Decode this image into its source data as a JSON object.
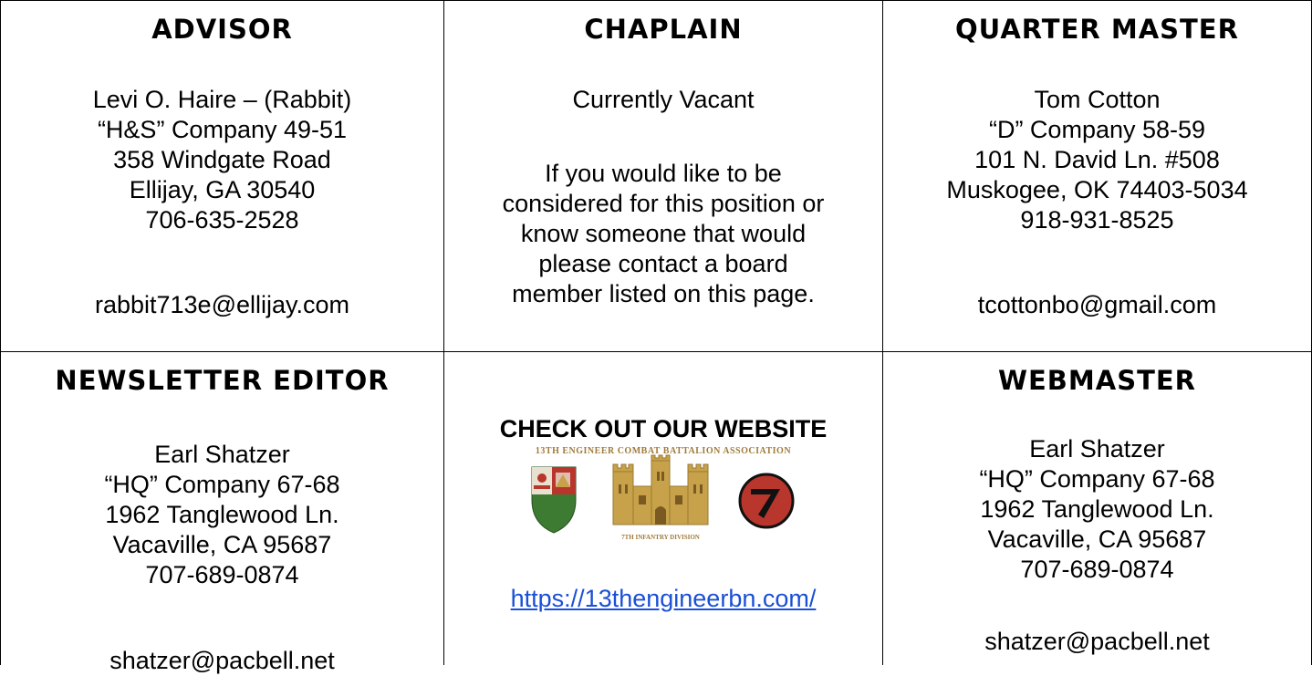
{
  "colors": {
    "border": "#000000",
    "text": "#000000",
    "link": "#1a4fd6",
    "crest_gold": "#c8a24a",
    "crest_red": "#b8362b",
    "crest_green": "#3d7a32"
  },
  "advisor": {
    "heading": "ADVISOR",
    "lines": [
      "Levi O. Haire – (Rabbit)",
      "“H&S” Company 49-51",
      "358 Windgate Road",
      "Ellijay, GA 30540",
      "706-635-2528"
    ],
    "email": "rabbit713e@ellijay.com"
  },
  "chaplain": {
    "heading": "CHAPLAIN",
    "status": "Currently Vacant",
    "lines": [
      "If you would like to be",
      "considered for this position or",
      "know someone that would",
      "please contact a board",
      "member listed on this page."
    ]
  },
  "quartermaster": {
    "heading": "QUARTER MASTER",
    "lines": [
      "Tom Cotton",
      "“D” Company 58-59",
      "101 N. David Ln. #508",
      "Muskogee, OK 74403-5034",
      "918-931-8525"
    ],
    "email": "tcottonbo@gmail.com"
  },
  "newsletter": {
    "heading": "NEWSLETTER EDITOR",
    "lines": [
      "Earl Shatzer",
      "“HQ” Company 67-68",
      "1962 Tanglewood Ln.",
      "Vacaville, CA 95687",
      "707-689-0874"
    ],
    "email": "shatzer@pacbell.net"
  },
  "website": {
    "heading": "CHECK OUT OUR WEBSITE",
    "logo_banner": "13TH ENGINEER COMBAT BATTALION ASSOCIATION",
    "logo_subtext": "7TH INFANTRY DIVISION",
    "url": "https://13thengineerbn.com/",
    "icons": [
      "regimental-crest-icon",
      "engineer-castle-icon",
      "infantry-division-patch-icon"
    ]
  },
  "webmaster": {
    "heading": "WEBMASTER",
    "lines": [
      "Earl Shatzer",
      "“HQ” Company 67-68",
      "1962 Tanglewood Ln.",
      "Vacaville, CA 95687",
      "707-689-0874"
    ],
    "email": "shatzer@pacbell.net"
  }
}
